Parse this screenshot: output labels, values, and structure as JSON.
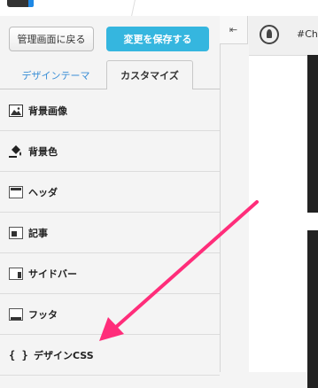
{
  "toolbar": {
    "back_label": "管理画面に戻る",
    "save_label": "変更を保存する"
  },
  "tabs": [
    {
      "label": "デザインテーマ",
      "active": false
    },
    {
      "label": "カスタマイズ",
      "active": true
    }
  ],
  "menu": {
    "items": [
      {
        "label": "背景画像",
        "icon": "background-image-icon"
      },
      {
        "label": "背景色",
        "icon": "paint-bucket-icon"
      },
      {
        "label": "ヘッダ",
        "icon": "header-layout-icon"
      },
      {
        "label": "記事",
        "icon": "article-layout-icon"
      },
      {
        "label": "サイドバー",
        "icon": "sidebar-layout-icon"
      },
      {
        "label": "フッタ",
        "icon": "footer-layout-icon"
      },
      {
        "label": "デザインCSS",
        "icon": "css-braces-icon"
      }
    ]
  },
  "collapse": {
    "glyph": "⇤"
  },
  "preview": {
    "hash_text": "#Ch"
  },
  "colors": {
    "save_button": "#35b6df",
    "active_link": "#3a8ed6",
    "annotation_arrow": "#ff2d7a"
  },
  "css_icon_glyph": "{ }"
}
